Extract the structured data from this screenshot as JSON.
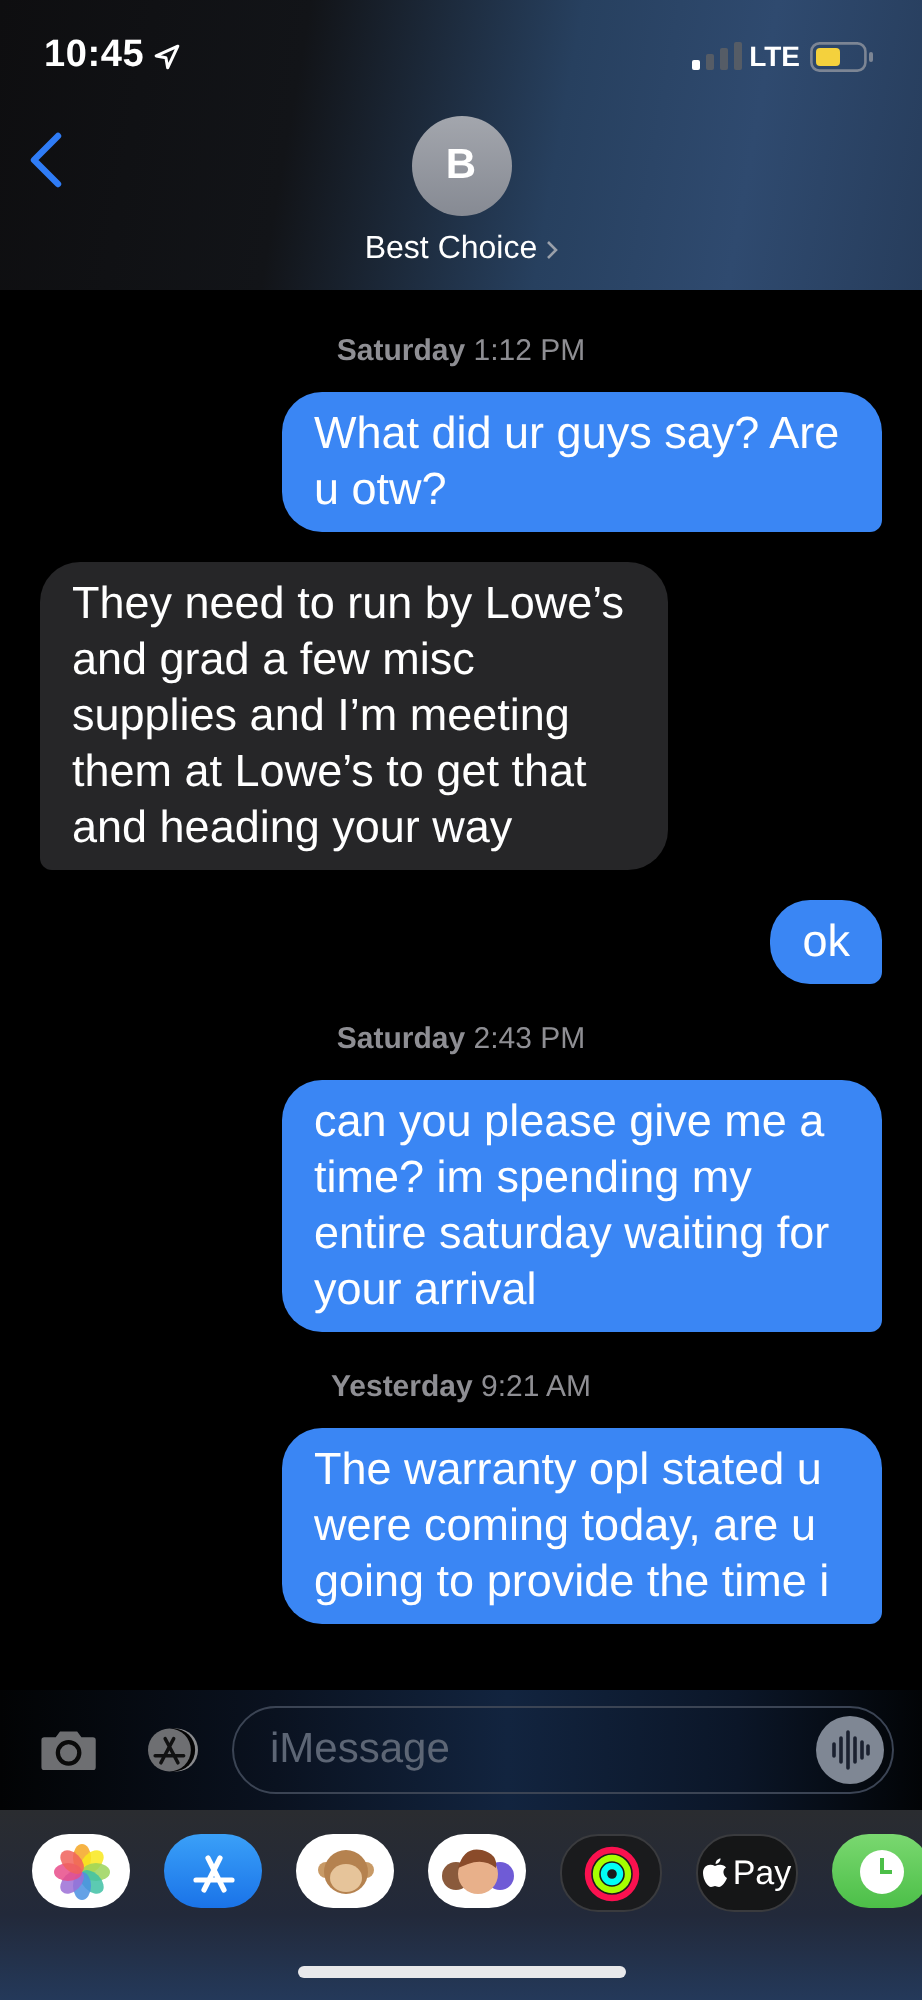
{
  "status_bar": {
    "time": "10:45",
    "network": "LTE"
  },
  "header": {
    "avatar_initial": "B",
    "contact_name": "Best Choice"
  },
  "messages": [
    {
      "kind": "timestamp",
      "day": "Saturday",
      "time": "1:12 PM"
    },
    {
      "kind": "sent_message",
      "text": "What did ur guys say? Are u otw?"
    },
    {
      "kind": "received_message",
      "text": "They need to run by Lowe’s and grad a few misc supplies and I’m meeting them at Lowe’s to get that and heading your way"
    },
    {
      "kind": "sent_message",
      "text": "ok"
    },
    {
      "kind": "timestamp",
      "day": "Saturday",
      "time": "2:43 PM"
    },
    {
      "kind": "sent_message",
      "text": "can you please give me a time? im spending my entire saturday waiting for your arrival"
    },
    {
      "kind": "timestamp",
      "day": "Yesterday",
      "time": "9:21 AM"
    },
    {
      "kind": "sent_message",
      "text": "The warranty opl stated u were coming today, are u going to provide the time i"
    }
  ],
  "compose": {
    "placeholder": "iMessage"
  },
  "app_drawer": [
    {
      "kind": "photos"
    },
    {
      "kind": "appstore"
    },
    {
      "kind": "animoji"
    },
    {
      "kind": "memoji"
    },
    {
      "kind": "activity"
    },
    {
      "kind": "applepay",
      "label": "Pay"
    },
    {
      "kind": "clock"
    }
  ]
}
